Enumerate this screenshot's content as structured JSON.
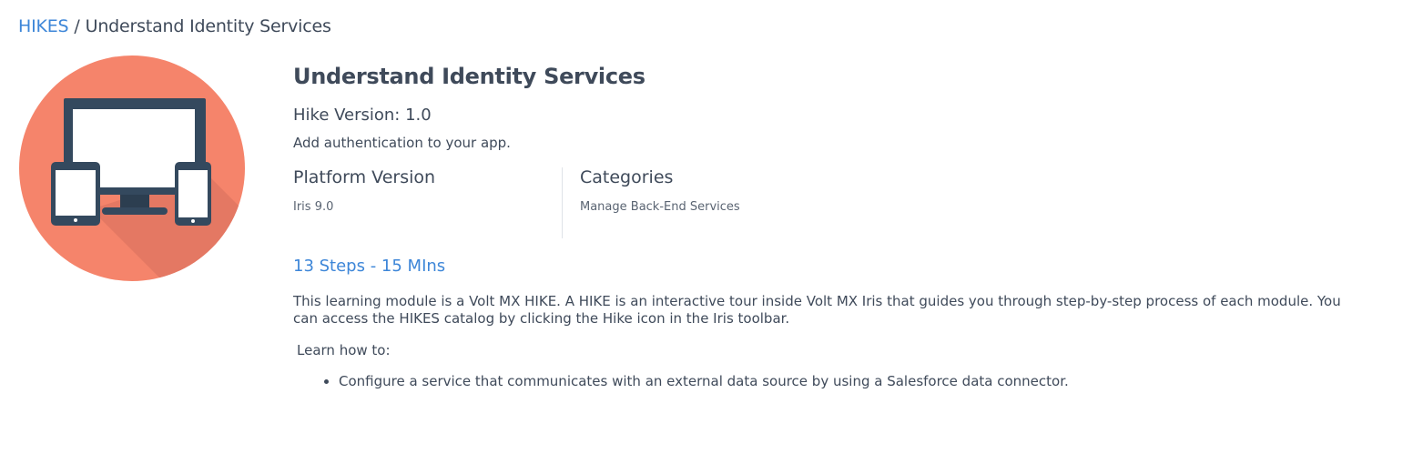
{
  "breadcrumb": {
    "root": "HIKES",
    "separator": "/",
    "current": "Understand Identity Services"
  },
  "hero_icon": "devices-icon",
  "colors": {
    "accent_link": "#3d86d8",
    "circle": "#f5846b",
    "circle_shadow": "#e07561",
    "device_frame": "#34495e",
    "screen": "#ffffff"
  },
  "hike": {
    "title": "Understand Identity Services",
    "version": "Hike Version: 1.0",
    "description": "Add authentication to your app.",
    "platform_heading": "Platform Version",
    "platform_value": "Iris 9.0",
    "categories_heading": "Categories",
    "categories_value": "Manage Back-End Services",
    "steps": "13 Steps - 15 MIns",
    "about": "This learning module is a Volt MX HIKE.  A HIKE is an interactive tour inside Volt MX Iris that guides you through step-by-step process of each module. You can access the HIKES catalog by clicking the Hike icon in the Iris toolbar.",
    "learn_heading": "Learn how to:",
    "learn_items": [
      "Configure a service that communicates with an external data source by using a Salesforce data connector."
    ]
  }
}
